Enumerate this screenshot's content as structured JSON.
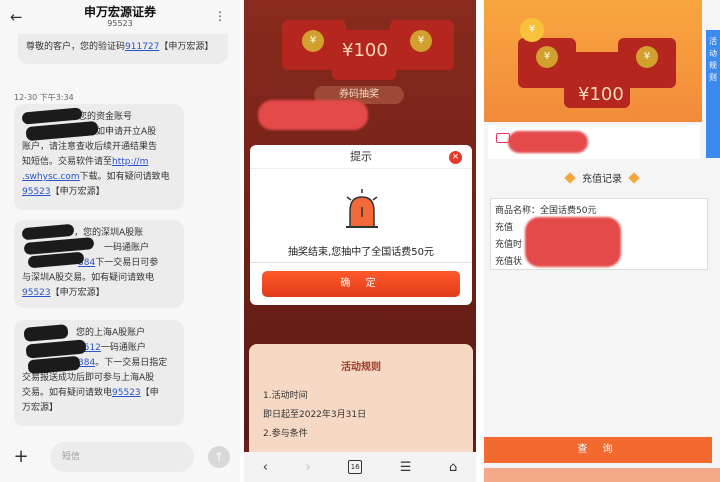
{
  "panel1": {
    "title": "申万宏源证券",
    "subtitle": "95523",
    "first_msg_prefix": "尊敬的客户，您的验证码",
    "first_msg_code": "911727",
    "first_msg_suffix": "【申万宏源】",
    "timestamp": "12-30 下午3:34",
    "msg1_line1": "好，您的资金账号",
    "msg1_line2": "如申请开立A股",
    "msg1_line3": "账户，请注意查收后续开通结果告",
    "msg1_line4": "知短信。交易软件请至",
    "msg1_link1": "http://m",
    "msg1_link2": ".swhysc.com",
    "msg1_line5": "下载。如有疑问请致电",
    "msg1_phone": "95523",
    "msg1_sign": "【申万宏源】",
    "msg2_line1": "，您的深圳A股账",
    "msg2_line2": "一码通账户",
    "msg2_line3": "下一交易日可参",
    "msg2_line4": "与深圳A股交易。如有疑问请致电",
    "msg2_phone": "95523",
    "msg2_sign": "【申万宏源】",
    "msg2_frag1": "384",
    "msg3_line1": "您的上海A股账户",
    "msg3_frag1": "7512",
    "msg3_line2": "一码通账户",
    "msg3_frag2": "384",
    "msg3_line3": "。下一交易日指定",
    "msg3_line4": "交易报送成功后即可参与上海A股",
    "msg3_line5": "交易。如有疑问请致电",
    "msg3_phone": "95523",
    "msg3_sign_a": "【申",
    "msg3_sign_b": "万宏源】",
    "input_placeholder": "短信"
  },
  "panel2": {
    "amount": "¥100",
    "tab_label": "券码抽奖",
    "modal_title": "提示",
    "modal_text": "抽奖结束,您抽中了全国话费50元",
    "confirm_label": "确 定",
    "rules_title": "活动规则",
    "rule1": "1.活动时间",
    "rule2": "即日起至2022年3月31日",
    "rule3": "2.参与条件",
    "tab_count": "16"
  },
  "panel3": {
    "amount": "¥100",
    "side_tab": "活动规则",
    "section_title": "充值记录",
    "product_label": "商品名称：全国话费50元",
    "row2": "充值",
    "row3": "充值时",
    "row4": "充值状",
    "query_label": "查 询"
  }
}
